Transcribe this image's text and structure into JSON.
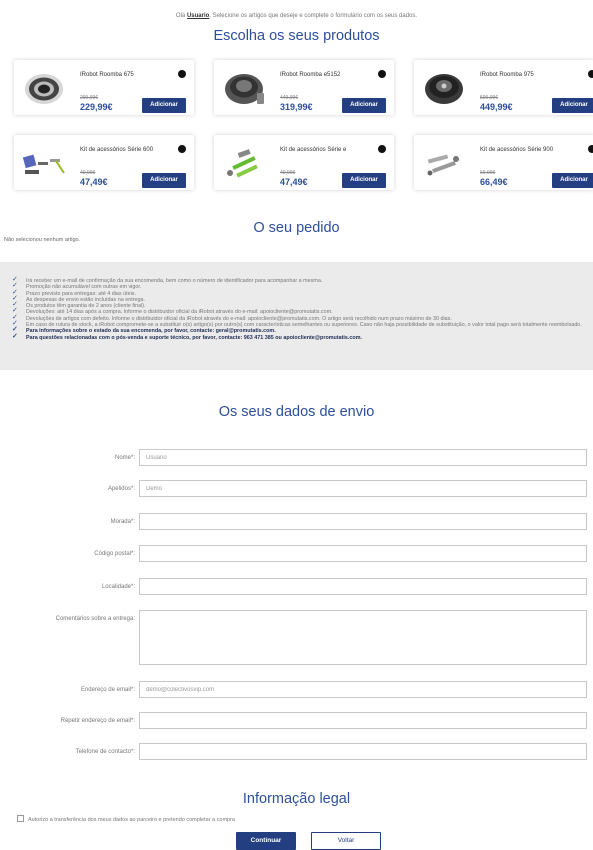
{
  "greeting": {
    "prefix": "Olá ",
    "user": "Usuario",
    "suffix": ". Selecione os artigos que deseje e complete o formulário com os seus dados."
  },
  "products_title": "Escolha os seus produtos",
  "products": [
    {
      "name": "IRobot Roomba 675",
      "old_price": "299,99€",
      "price": "229,99€",
      "add": "Adicionar"
    },
    {
      "name": "IRobot Roomba e5152",
      "old_price": "449,99€",
      "price": "319,99€",
      "add": "Adicionar"
    },
    {
      "name": "IRobot Roomba 975",
      "old_price": "599,99€",
      "price": "449,99€",
      "add": "Adicionar"
    },
    {
      "name": "Kit de acessórios Série 600",
      "old_price": "49,99€",
      "price": "47,49€",
      "add": "Adicionar"
    },
    {
      "name": "Kit de acessórios Série e",
      "old_price": "49,99€",
      "price": "47,49€",
      "add": "Adicionar"
    },
    {
      "name": "Kit de acessórios Série 900",
      "old_price": "69,99€",
      "price": "66,49€",
      "add": "Adicionar"
    }
  ],
  "order_title": "O seu pedido",
  "order_empty": "Não selecionou nenhum artigo.",
  "info_items": [
    "Irá receber um e-mail de confirmação da sua encomenda, bem como o número de identificador para acompanhar a mesma.",
    "Promoção não acumulável com outras em vigor.",
    "Prazo previsto para entregas: até 4 dias úteis.",
    "As despesas de envio estão incluídas na entrega.",
    "Os produtos têm garantia de 2 anos (cliente final).",
    "Devoluções: até 14 dias após a compra. Informe o distribuidor oficial da iRobot através do e-mail: apoiocliente@promutatis.com.",
    "Devoluções de artigos com defeito. Informe o distribuidor oficial da iRobot através do e-mail: apoiocliente@promutatis.com. O artigo será recolhido num prazo máximo de 30 dias.",
    "Em caso de rutura de stock, a iRobot compromete-se a substituir o(s) artigo(s) por outro(s) com características semelhantes ou superiores. Caso não haja possibilidade de substituição, o valor total pago será totalmente reembolsado.",
    "Para informações sobre o estado da sua encomenda, por favor, contacte: geral@promutatis.com.",
    "Para questões relacionadas com o pós-venda e suporte técnico, por favor, contacte: 963 471 385 ou apoiocliente@promutatis.com."
  ],
  "shipping_title": "Os seus dados de envio",
  "fields": [
    {
      "label": "Nome*:",
      "value": "Usuario"
    },
    {
      "label": "Apelidos*:",
      "value": "Demo"
    },
    {
      "label": "Morada*:",
      "value": ""
    },
    {
      "label": "Código postal*:",
      "value": ""
    },
    {
      "label": "Localidade*:",
      "value": ""
    },
    {
      "label": "Comentários sobre a entrega:",
      "value": ""
    },
    {
      "label": "Endereço de email*:",
      "value": "demo@colectivosvip.com"
    },
    {
      "label": "Repetir endereço de email*:",
      "value": ""
    },
    {
      "label": "Telefone de contacto*:",
      "value": ""
    }
  ],
  "legal_title": "Informação legal",
  "legal_checkbox": "Autorizo a transferência dos meus dados ao parceiro e pretendo completar a compra",
  "buttons": {
    "continue": "Continuar",
    "back": "Voltar"
  }
}
